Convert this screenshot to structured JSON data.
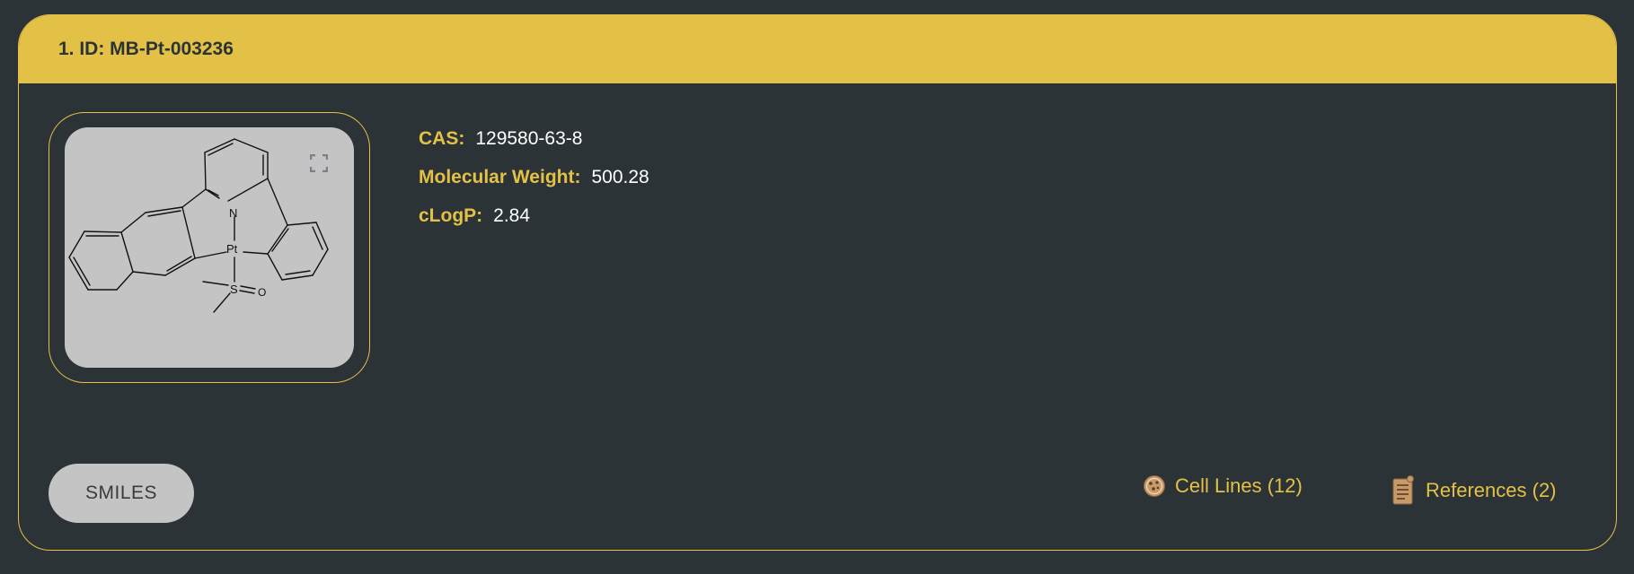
{
  "card": {
    "title": "1. ID: MB-Pt-003236"
  },
  "structure": {
    "expand_icon": "expand-icon",
    "atom_labels": {
      "n": "N",
      "pt": "Pt",
      "s": "S",
      "o": "O"
    }
  },
  "properties": [
    {
      "label": "CAS:",
      "value": "129580-63-8"
    },
    {
      "label": "Molecular Weight:",
      "value": "500.28"
    },
    {
      "label": "cLogP:",
      "value": "2.84"
    }
  ],
  "actions": {
    "smiles_label": "SMILES",
    "cell_lines_label": "Cell Lines (12)",
    "cell_lines_icon": "petri-dish-icon",
    "references_label": "References (2)",
    "references_icon": "document-icon"
  },
  "colors": {
    "background": "#2c3337",
    "accent": "#e3c147",
    "panel": "#c4c4c4",
    "icon_brown": "#c89a6a"
  }
}
